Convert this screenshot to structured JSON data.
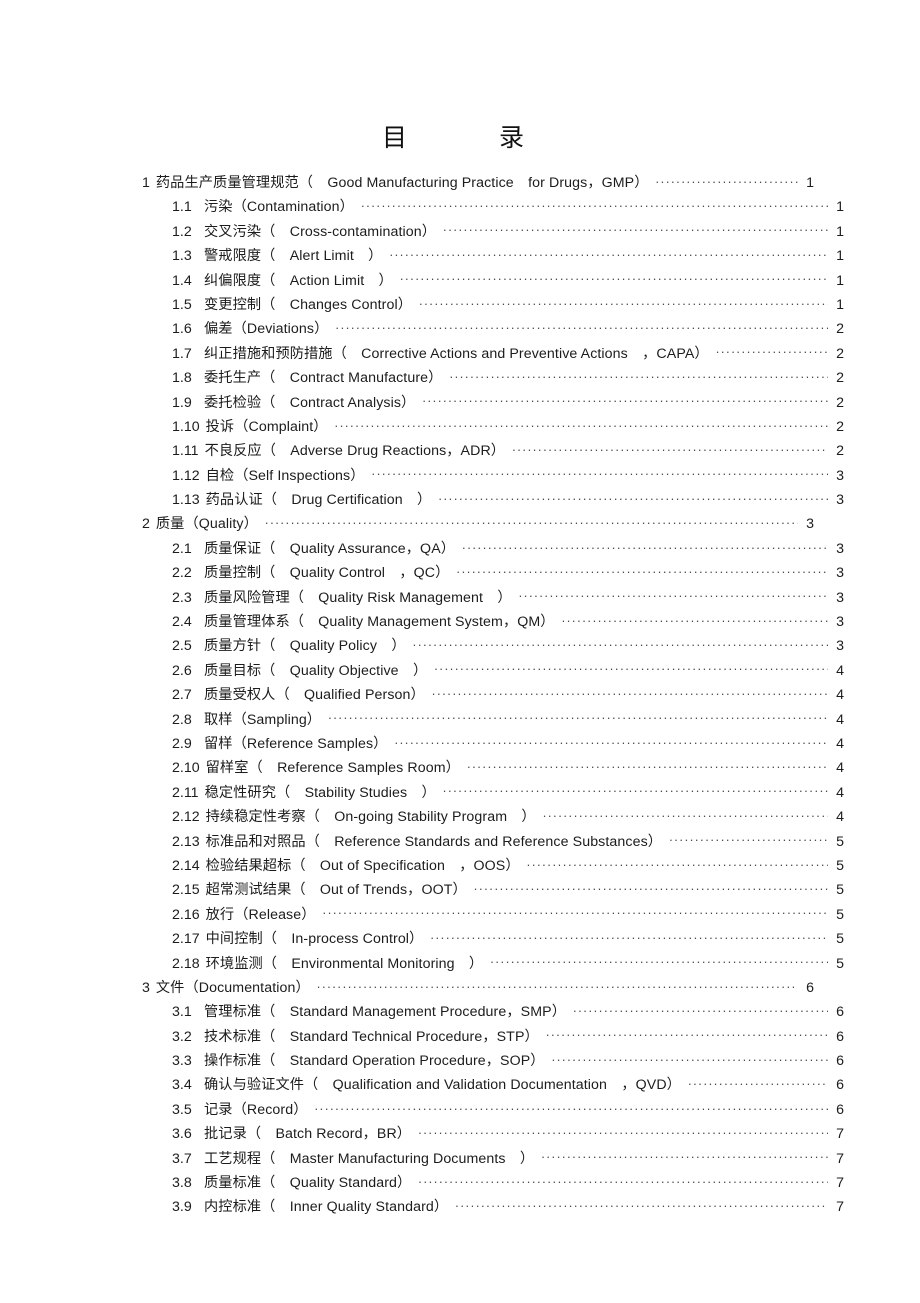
{
  "document": {
    "title": "目　　录",
    "page_background": "#ffffff",
    "text_color": "#1c1c1c"
  },
  "toc": {
    "entries": [
      {
        "level": 1,
        "number": "1",
        "label": "药品生产质量管理规范（　Good Manufacturing Practice　for Drugs，GMP）",
        "page": "1"
      },
      {
        "level": 2,
        "number": "1.1",
        "label": "污染（Contamination）",
        "page": "1"
      },
      {
        "level": 2,
        "number": "1.2",
        "label": "交叉污染（　Cross-contamination）",
        "page": "1"
      },
      {
        "level": 2,
        "number": "1.3",
        "label": "警戒限度（　Alert Limit　）",
        "page": "1"
      },
      {
        "level": 2,
        "number": "1.4",
        "label": "纠偏限度（　Action Limit　）",
        "page": "1"
      },
      {
        "level": 2,
        "number": "1.5",
        "label": "变更控制（　Changes Control）",
        "page": "1"
      },
      {
        "level": 2,
        "number": "1.6",
        "label": "偏差（Deviations）",
        "page": "2"
      },
      {
        "level": 2,
        "number": "1.7",
        "label": "纠正措施和预防措施（　Corrective Actions and Preventive Actions　，CAPA）",
        "page": "2"
      },
      {
        "level": 2,
        "number": "1.8",
        "label": "委托生产（　Contract Manufacture）",
        "page": "2"
      },
      {
        "level": 2,
        "number": "1.9",
        "label": "委托检验（　Contract Analysis）",
        "page": "2"
      },
      {
        "level": 2,
        "number": "1.10",
        "label": "投诉（Complaint）",
        "page": "2"
      },
      {
        "level": 2,
        "number": "1.11",
        "label": "不良反应（　Adverse Drug Reactions，ADR）",
        "page": "2"
      },
      {
        "level": 2,
        "number": "1.12",
        "label": "自检（Self Inspections）",
        "page": "3"
      },
      {
        "level": 2,
        "number": "1.13",
        "label": "药品认证（　Drug Certification　）",
        "page": "3"
      },
      {
        "level": 1,
        "number": "2",
        "label": "质量（Quality）",
        "page": "3"
      },
      {
        "level": 2,
        "number": "2.1",
        "label": "质量保证（　Quality Assurance，QA）",
        "page": "3"
      },
      {
        "level": 2,
        "number": "2.2",
        "label": "质量控制（　Quality Control　，QC）",
        "page": "3"
      },
      {
        "level": 2,
        "number": "2.3",
        "label": "质量风险管理（　Quality Risk Management　）",
        "page": "3"
      },
      {
        "level": 2,
        "number": "2.4",
        "label": "质量管理体系（　Quality Management System，QM）",
        "page": "3"
      },
      {
        "level": 2,
        "number": "2.5",
        "label": "质量方针（　Quality Policy　）",
        "page": "3"
      },
      {
        "level": 2,
        "number": "2.6",
        "label": "质量目标（　Quality Objective　）",
        "page": "4"
      },
      {
        "level": 2,
        "number": "2.7",
        "label": "质量受权人（　Qualified Person）",
        "page": "4"
      },
      {
        "level": 2,
        "number": "2.8",
        "label": "取样（Sampling）",
        "page": "4"
      },
      {
        "level": 2,
        "number": "2.9",
        "label": "留样（Reference Samples）",
        "page": "4"
      },
      {
        "level": 2,
        "number": "2.10",
        "label": "留样室（　Reference Samples Room）",
        "page": "4"
      },
      {
        "level": 2,
        "number": "2.11",
        "label": "稳定性研究（　Stability Studies　）",
        "page": "4"
      },
      {
        "level": 2,
        "number": "2.12",
        "label": "持续稳定性考察（　On-going Stability Program　）",
        "page": "4"
      },
      {
        "level": 2,
        "number": "2.13",
        "label": "标准品和对照品（　Reference Standards and Reference Substances）",
        "page": "5"
      },
      {
        "level": 2,
        "number": "2.14",
        "label": "检验结果超标（　Out of Specification　，OOS）",
        "page": "5"
      },
      {
        "level": 2,
        "number": "2.15",
        "label": "超常测试结果（　Out of Trends，OOT）",
        "page": "5"
      },
      {
        "level": 2,
        "number": "2.16",
        "label": "放行（Release）",
        "page": "5"
      },
      {
        "level": 2,
        "number": "2.17",
        "label": "中间控制（　In-process Control）",
        "page": "5"
      },
      {
        "level": 2,
        "number": "2.18",
        "label": "环境监测（　Environmental Monitoring　）",
        "page": "5"
      },
      {
        "level": 1,
        "number": "3",
        "label": "文件（Documentation）",
        "page": "6"
      },
      {
        "level": 2,
        "number": "3.1",
        "label": "管理标准（　Standard Management Procedure，SMP）",
        "page": "6"
      },
      {
        "level": 2,
        "number": "3.2",
        "label": "技术标准（　Standard Technical Procedure，STP）",
        "page": "6"
      },
      {
        "level": 2,
        "number": "3.3",
        "label": "操作标准（　Standard Operation Procedure，SOP）",
        "page": "6"
      },
      {
        "level": 2,
        "number": "3.4",
        "label": "确认与验证文件（　Qualification and Validation Documentation　，QVD）",
        "page": "6"
      },
      {
        "level": 2,
        "number": "3.5",
        "label": "记录（Record）",
        "page": "6"
      },
      {
        "level": 2,
        "number": "3.6",
        "label": "批记录（　Batch Record，BR）",
        "page": "7"
      },
      {
        "level": 2,
        "number": "3.7",
        "label": "工艺规程（　Master Manufacturing Documents　）",
        "page": "7"
      },
      {
        "level": 2,
        "number": "3.8",
        "label": "质量标准（　Quality Standard）",
        "page": "7"
      },
      {
        "level": 2,
        "number": "3.9",
        "label": "内控标准（　Inner Quality Standard）",
        "page": "7"
      }
    ]
  }
}
